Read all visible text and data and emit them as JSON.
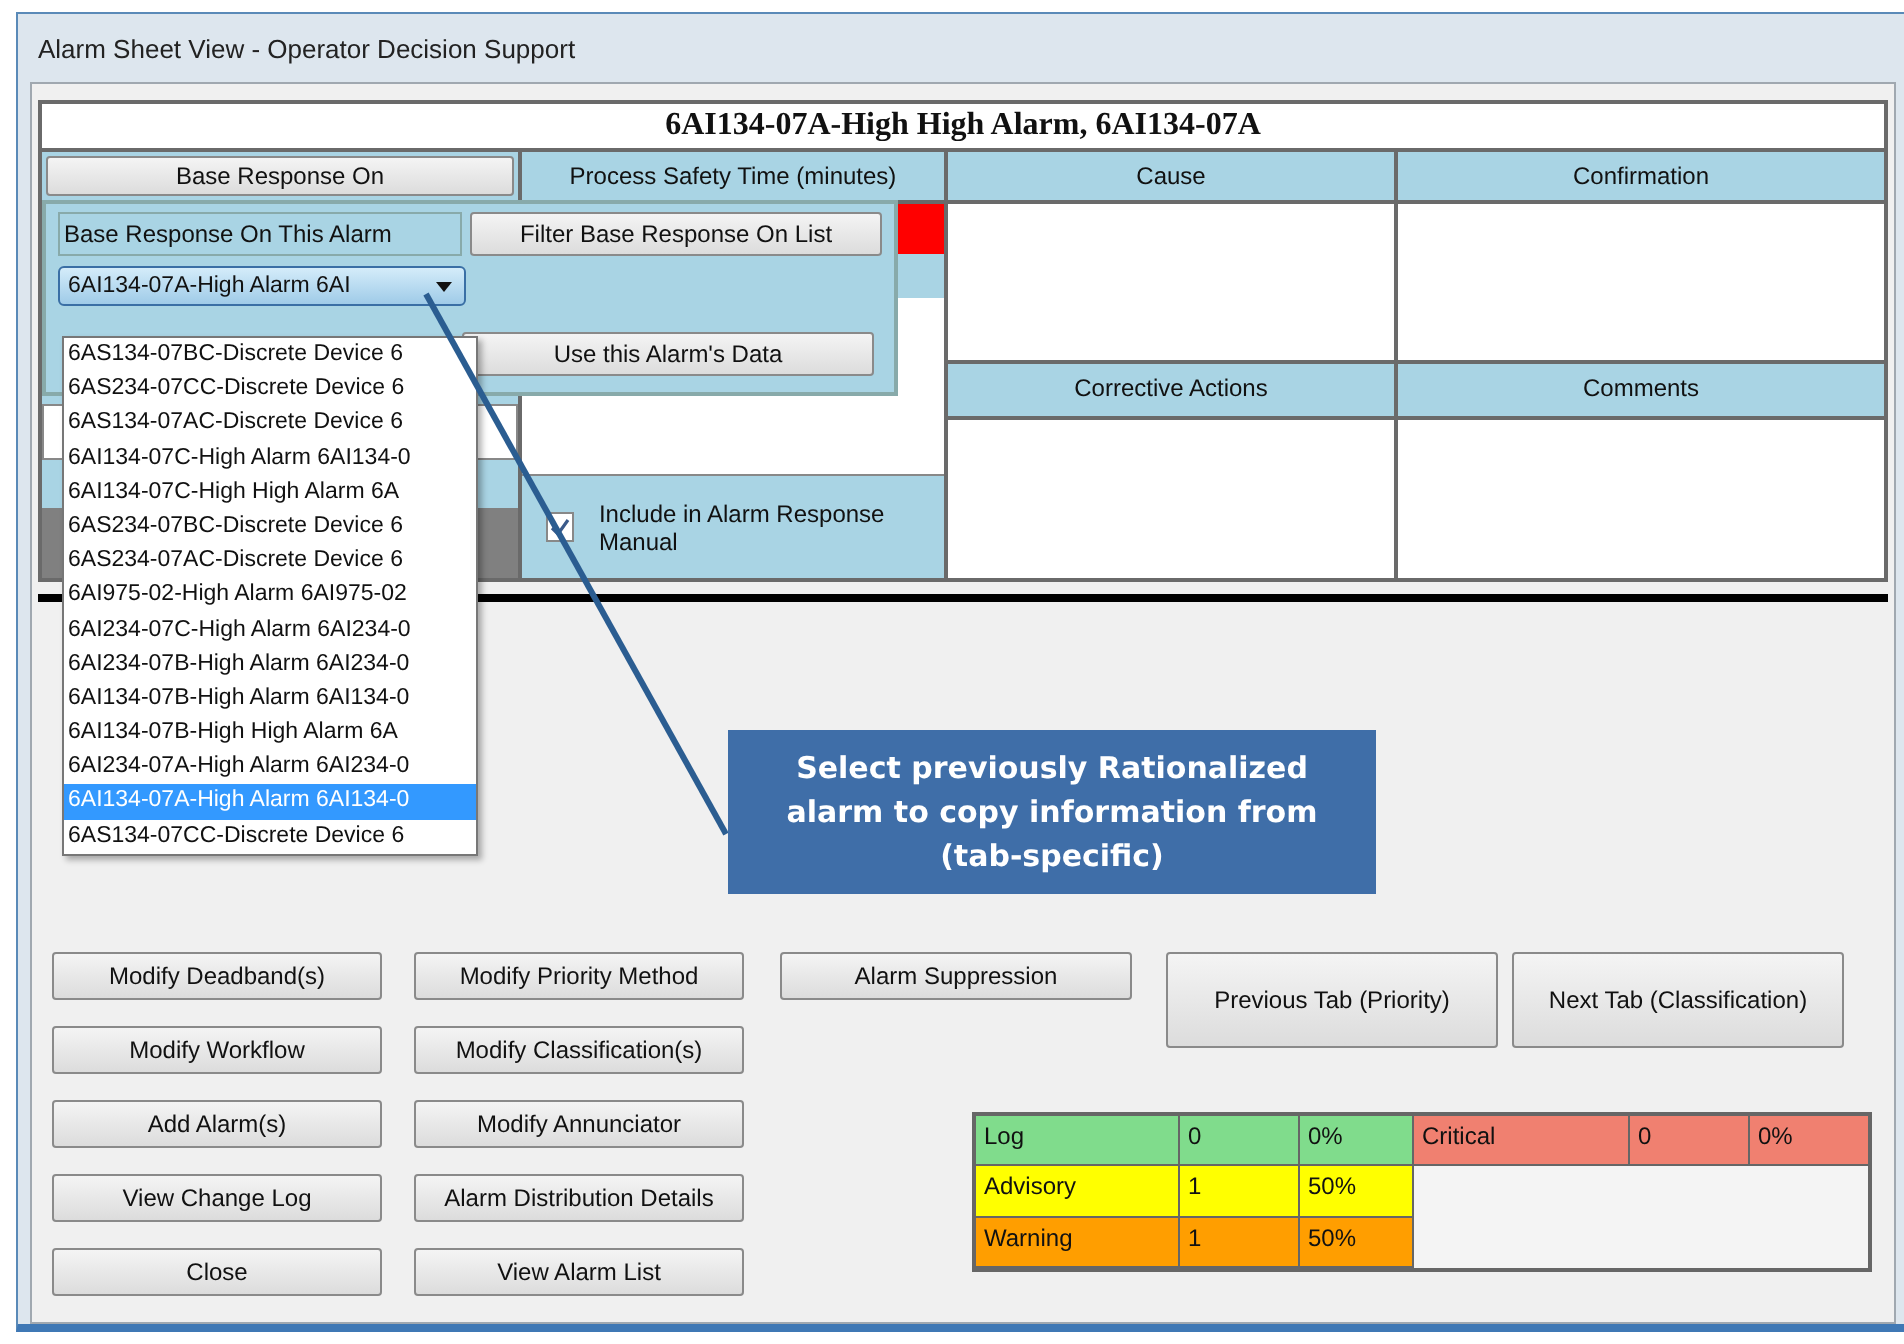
{
  "window": {
    "title": "Alarm Sheet View - Operator Decision Support"
  },
  "alarm_header": "6AI134-07A-High High Alarm, 6AI134-07A",
  "base_response_button": "Base Response On",
  "columns": {
    "process_safety_time": "Process Safety Time (minutes)",
    "cause": "Cause",
    "confirmation": "Confirmation",
    "corrective_actions": "Corrective Actions",
    "comments": "Comments"
  },
  "include_checkbox": {
    "label": "Include in Alarm Response Manual",
    "checked": true
  },
  "base_response_panel": {
    "label": "Base Response On This Alarm",
    "combo_value": "6AI134-07A-High Alarm 6AI",
    "filter_button": "Filter Base Response On List",
    "use_button": "Use this Alarm's Data",
    "options": [
      {
        "text": "6AS134-07BC-Discrete Device 6",
        "selected": false
      },
      {
        "text": "6AS234-07CC-Discrete Device 6",
        "selected": false
      },
      {
        "text": "6AS134-07AC-Discrete Device 6",
        "selected": false
      },
      {
        "text": "6AI134-07C-High Alarm 6AI134-0",
        "selected": false
      },
      {
        "text": "6AI134-07C-High High Alarm 6A",
        "selected": false
      },
      {
        "text": "6AS234-07BC-Discrete Device 6",
        "selected": false
      },
      {
        "text": "6AS234-07AC-Discrete Device 6",
        "selected": false
      },
      {
        "text": "6AI975-02-High Alarm 6AI975-02",
        "selected": false
      },
      {
        "text": "6AI234-07C-High Alarm 6AI234-0",
        "selected": false
      },
      {
        "text": "6AI234-07B-High Alarm 6AI234-0",
        "selected": false
      },
      {
        "text": "6AI134-07B-High Alarm 6AI134-0",
        "selected": false
      },
      {
        "text": "6AI134-07B-High High Alarm 6A",
        "selected": false
      },
      {
        "text": "6AI234-07A-High Alarm 6AI234-0",
        "selected": false
      },
      {
        "text": "6AI134-07A-High Alarm 6AI134-0",
        "selected": true
      },
      {
        "text": "6AS134-07CC-Discrete Device 6",
        "selected": false
      }
    ]
  },
  "callout": "Select previously Rationalized alarm to copy information from (tab-specific)",
  "action_buttons": [
    [
      "Modify Deadband(s)",
      "Modify Priority Method",
      "Alarm Suppression"
    ],
    [
      "Modify Workflow",
      "Modify Classification(s)"
    ],
    [
      "Add Alarm(s)",
      "Modify Annunciator"
    ],
    [
      "View Change Log",
      "Alarm Distribution Details"
    ],
    [
      "Close",
      "View Alarm List"
    ]
  ],
  "nav_buttons": [
    "Previous Tab (Priority)",
    "Next Tab (Classification)"
  ],
  "priority_summary": {
    "rows": [
      {
        "label": "Log",
        "count": "0",
        "percent": "0%",
        "color": "#80dc8c"
      },
      {
        "label": "Advisory",
        "count": "1",
        "percent": "50%",
        "color": "#ffff00"
      },
      {
        "label": "Warning",
        "count": "1",
        "percent": "50%",
        "color": "#ff9e00"
      }
    ],
    "critical": {
      "label": "Critical",
      "count": "0",
      "percent": "0%",
      "color": "#f08070"
    }
  }
}
